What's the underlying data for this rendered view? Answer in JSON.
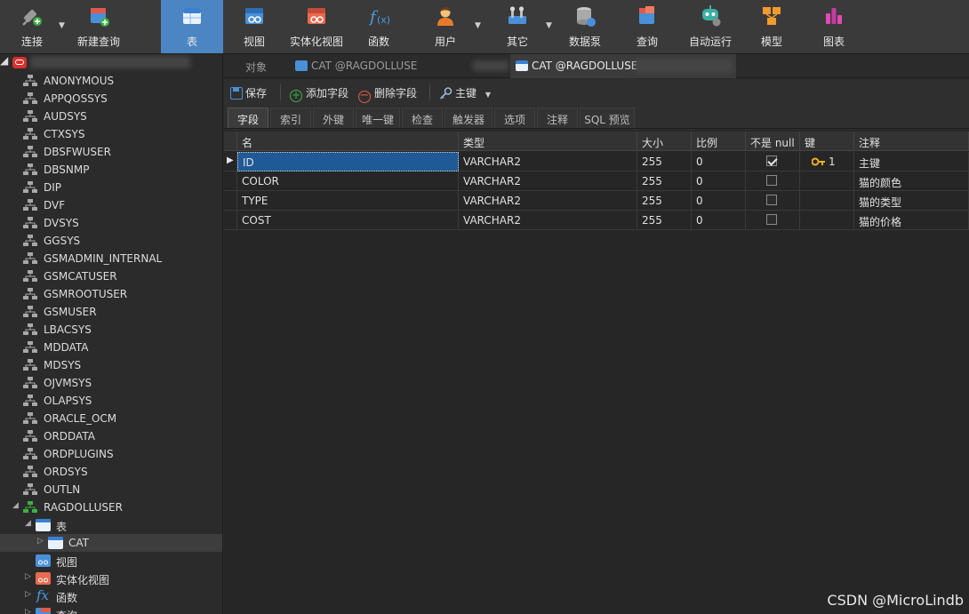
{
  "toolbar": {
    "connect": "连接",
    "new_query": "新建查询",
    "table": "表",
    "view": "视图",
    "mview": "实体化视图",
    "function": "函数",
    "user": "用户",
    "other": "其它",
    "datapump": "数据泵",
    "query": "查询",
    "autorun": "自动运行",
    "model": "模型",
    "chart": "图表"
  },
  "sidebar": {
    "schemas": [
      "ANONYMOUS",
      "APPQOSSYS",
      "AUDSYS",
      "CTXSYS",
      "DBSFWUSER",
      "DBSNMP",
      "DIP",
      "DVF",
      "DVSYS",
      "GGSYS",
      "GSMADMIN_INTERNAL",
      "GSMCATUSER",
      "GSMROOTUSER",
      "GSMUSER",
      "LBACSYS",
      "MDDATA",
      "MDSYS",
      "OJVMSYS",
      "OLAPSYS",
      "ORACLE_OCM",
      "ORDDATA",
      "ORDPLUGINS",
      "ORDSYS",
      "OUTLN"
    ],
    "open_schema": "RAGDOLLUSER",
    "tables_node": "表",
    "table_cat": "CAT",
    "views_node": "视图",
    "mviews_node": "实体化视图",
    "functions_node": "函数",
    "queries_node": "查询"
  },
  "tabs": {
    "objects": "对象",
    "tab1": "CAT @RAGDOLLUSE",
    "tab2": "CAT @RAGDOLLUSE"
  },
  "actions": {
    "save": "保存",
    "add_field": "添加字段",
    "delete_field": "删除字段",
    "primary_key": "主键"
  },
  "subtabs": [
    "字段",
    "索引",
    "外键",
    "唯一键",
    "检查",
    "触发器",
    "选项",
    "注释",
    "SQL 预览"
  ],
  "grid": {
    "columns": [
      "名",
      "类型",
      "大小",
      "比例",
      "不是 null",
      "键",
      "注释"
    ],
    "rows": [
      {
        "name": "ID",
        "type": "VARCHAR2",
        "size": "255",
        "scale": "0",
        "not_null": true,
        "key": "1",
        "comment": "主键"
      },
      {
        "name": "COLOR",
        "type": "VARCHAR2",
        "size": "255",
        "scale": "0",
        "not_null": false,
        "key": "",
        "comment": "猫的颜色"
      },
      {
        "name": "TYPE",
        "type": "VARCHAR2",
        "size": "255",
        "scale": "0",
        "not_null": false,
        "key": "",
        "comment": "猫的类型"
      },
      {
        "name": "COST",
        "type": "VARCHAR2",
        "size": "255",
        "scale": "0",
        "not_null": false,
        "key": "",
        "comment": "猫的价格"
      }
    ]
  },
  "watermark": "CSDN @MicroLindb"
}
